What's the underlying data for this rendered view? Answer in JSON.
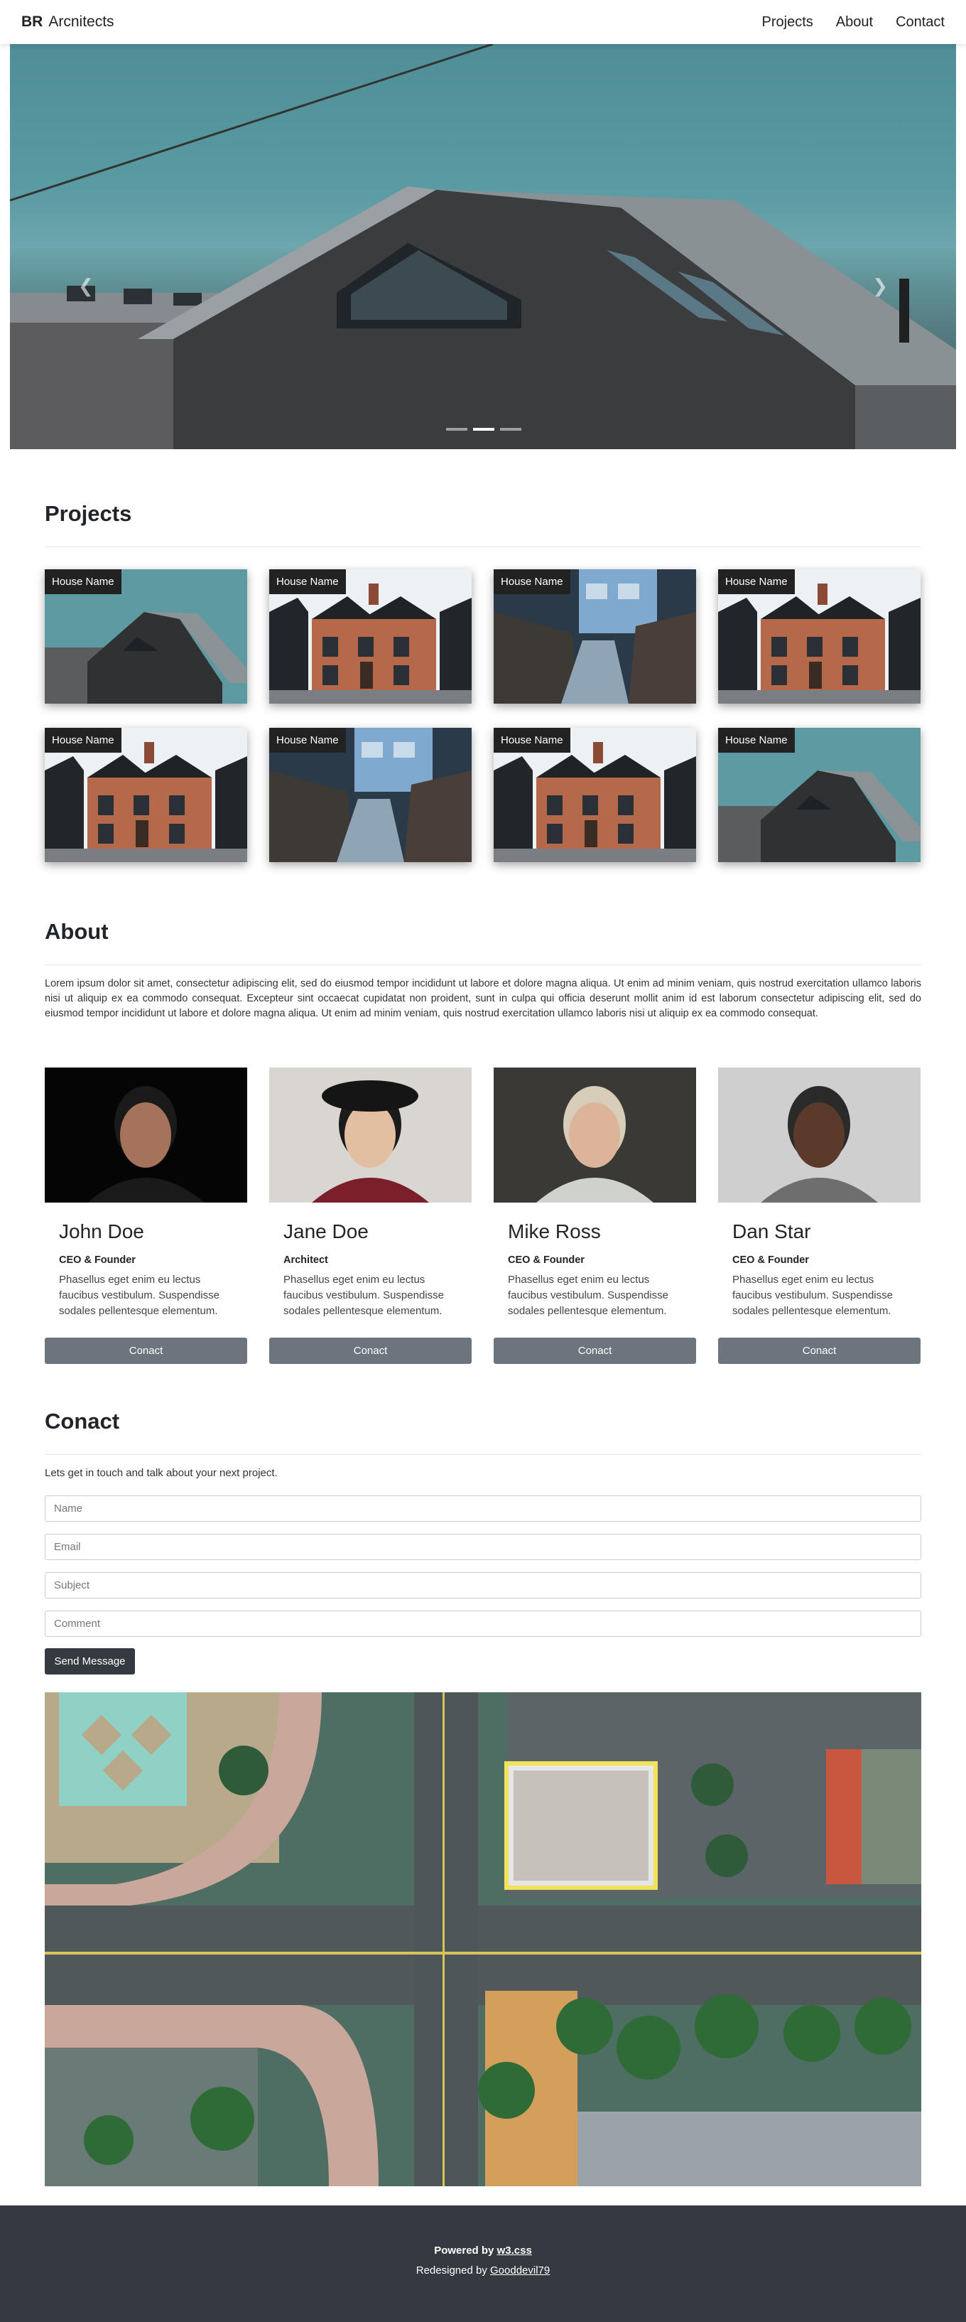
{
  "navbar": {
    "brand_bold": "BR",
    "brand_text": "Arcnitects",
    "links": [
      "Projects",
      "About",
      "Contact"
    ]
  },
  "hero": {
    "prev_icon": "chevron-left-icon",
    "next_icon": "chevron-right-icon",
    "indicators": 3,
    "active_indicator": 2
  },
  "projects": {
    "title": "Projects",
    "card_label": "House Name",
    "cards": [
      {
        "label": "House Name",
        "image": "dark-barn-house"
      },
      {
        "label": "House Name",
        "image": "brick-houses"
      },
      {
        "label": "House Name",
        "image": "blue-house-path"
      },
      {
        "label": "House Name",
        "image": "brick-houses"
      },
      {
        "label": "House Name",
        "image": "brick-houses"
      },
      {
        "label": "House Name",
        "image": "blue-house-path"
      },
      {
        "label": "House Name",
        "image": "brick-houses"
      },
      {
        "label": "House Name",
        "image": "dark-barn-house"
      }
    ]
  },
  "about": {
    "title": "About",
    "text": "Lorem ipsum dolor sit amet, consectetur adipiscing elit, sed do eiusmod tempor incididunt ut labore et dolore magna aliqua. Ut enim ad minim veniam, quis nostrud exercitation ullamco laboris nisi ut aliquip ex ea commodo consequat. Excepteur sint occaecat cupidatat non proident, sunt in culpa qui officia deserunt mollit anim id est laborum consectetur adipiscing elit, sed do eiusmod tempor incididunt ut labore et dolore magna aliqua. Ut enim ad minim veniam, quis nostrud exercitation ullamco laboris nisi ut aliquip ex ea commodo consequat.",
    "team": [
      {
        "name": "John Doe",
        "role": "CEO & Founder",
        "desc": "Phasellus eget enim eu lectus faucibus vestibulum. Suspendisse sodales pellentesque elementum.",
        "button": "Conact"
      },
      {
        "name": "Jane Doe",
        "role": "Architect",
        "desc": "Phasellus eget enim eu lectus faucibus vestibulum. Suspendisse sodales pellentesque elementum.",
        "button": "Conact"
      },
      {
        "name": "Mike Ross",
        "role": "CEO & Founder",
        "desc": "Phasellus eget enim eu lectus faucibus vestibulum. Suspendisse sodales pellentesque elementum.",
        "button": "Conact"
      },
      {
        "name": "Dan Star",
        "role": "CEO & Founder",
        "desc": "Phasellus eget enim eu lectus faucibus vestibulum. Suspendisse sodales pellentesque elementum.",
        "button": "Conact"
      }
    ]
  },
  "contact": {
    "title": "Conact",
    "intro": "Lets get in touch and talk about your next project.",
    "name_placeholder": "Name",
    "email_placeholder": "Email",
    "subject_placeholder": "Subject",
    "comment_placeholder": "Comment",
    "send_label": "Send Message"
  },
  "footer": {
    "powered_prefix": "Powered by",
    "powered_link": "w3.css",
    "redesigned_prefix": "Redesigned by",
    "redesigned_link": "Gooddevil79"
  },
  "colors": {
    "navbar_bg": "#ffffff",
    "footer_bg": "#343a40",
    "team_button": "#6c757d",
    "send_button": "#343a40",
    "label_bg": "#222222"
  }
}
